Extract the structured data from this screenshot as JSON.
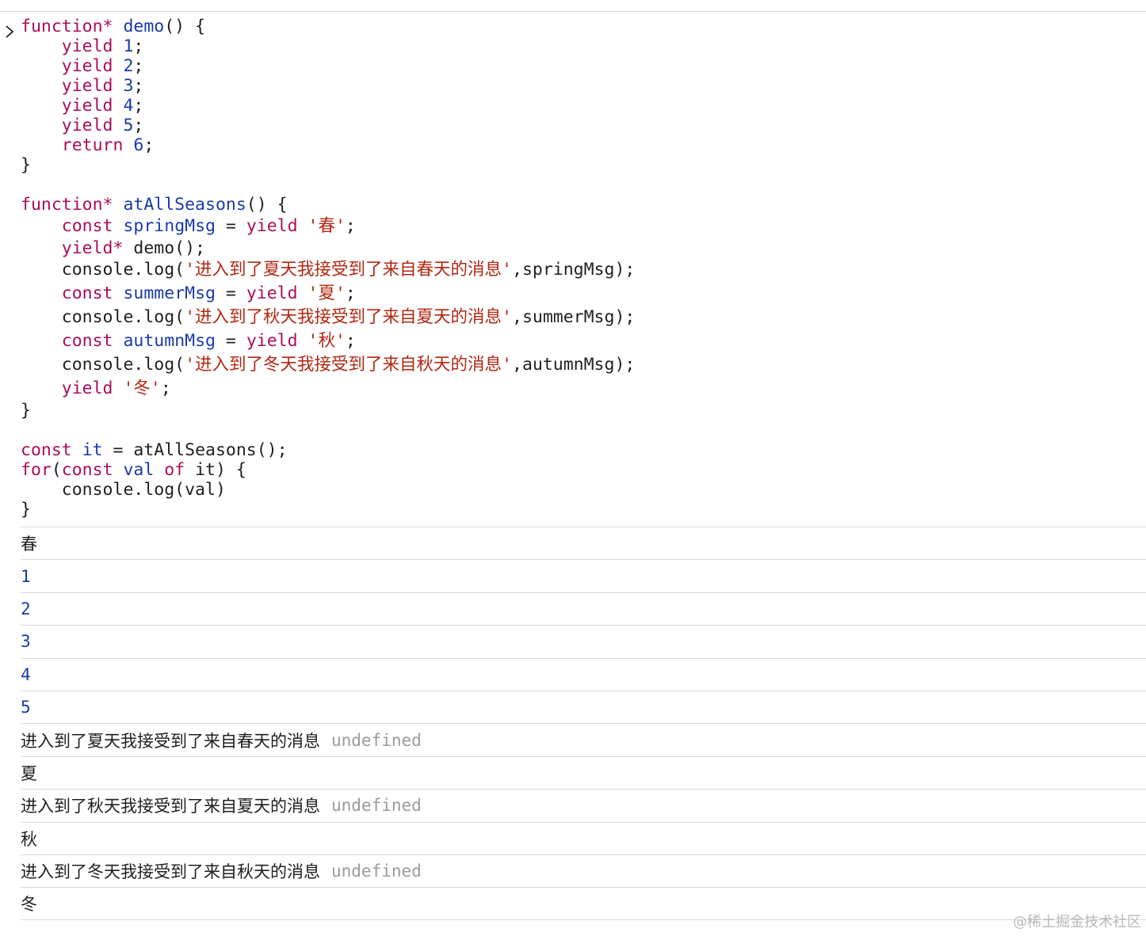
{
  "code": {
    "lines": [
      {
        "tokens": [
          {
            "t": "function*",
            "c": "kw"
          },
          {
            "t": " ",
            "c": "plain"
          },
          {
            "t": "demo",
            "c": "fn"
          },
          {
            "t": "() {",
            "c": "plain"
          }
        ]
      },
      {
        "tokens": [
          {
            "t": "    ",
            "c": "plain"
          },
          {
            "t": "yield",
            "c": "kw"
          },
          {
            "t": " ",
            "c": "plain"
          },
          {
            "t": "1",
            "c": "num"
          },
          {
            "t": ";",
            "c": "plain"
          }
        ]
      },
      {
        "tokens": [
          {
            "t": "    ",
            "c": "plain"
          },
          {
            "t": "yield",
            "c": "kw"
          },
          {
            "t": " ",
            "c": "plain"
          },
          {
            "t": "2",
            "c": "num"
          },
          {
            "t": ";",
            "c": "plain"
          }
        ]
      },
      {
        "tokens": [
          {
            "t": "    ",
            "c": "plain"
          },
          {
            "t": "yield",
            "c": "kw"
          },
          {
            "t": " ",
            "c": "plain"
          },
          {
            "t": "3",
            "c": "num"
          },
          {
            "t": ";",
            "c": "plain"
          }
        ]
      },
      {
        "tokens": [
          {
            "t": "    ",
            "c": "plain"
          },
          {
            "t": "yield",
            "c": "kw"
          },
          {
            "t": " ",
            "c": "plain"
          },
          {
            "t": "4",
            "c": "num"
          },
          {
            "t": ";",
            "c": "plain"
          }
        ]
      },
      {
        "tokens": [
          {
            "t": "    ",
            "c": "plain"
          },
          {
            "t": "yield",
            "c": "kw"
          },
          {
            "t": " ",
            "c": "plain"
          },
          {
            "t": "5",
            "c": "num"
          },
          {
            "t": ";",
            "c": "plain"
          }
        ]
      },
      {
        "tokens": [
          {
            "t": "    ",
            "c": "plain"
          },
          {
            "t": "return",
            "c": "kw"
          },
          {
            "t": " ",
            "c": "plain"
          },
          {
            "t": "6",
            "c": "num"
          },
          {
            "t": ";",
            "c": "plain"
          }
        ]
      },
      {
        "tokens": [
          {
            "t": "}",
            "c": "plain"
          }
        ]
      },
      {
        "tokens": []
      },
      {
        "tokens": [
          {
            "t": "function*",
            "c": "kw"
          },
          {
            "t": " ",
            "c": "plain"
          },
          {
            "t": "atAllSeasons",
            "c": "fn"
          },
          {
            "t": "() {",
            "c": "plain"
          }
        ]
      },
      {
        "tall": true,
        "tokens": [
          {
            "t": "    ",
            "c": "plain"
          },
          {
            "t": "const",
            "c": "kw"
          },
          {
            "t": " ",
            "c": "plain"
          },
          {
            "t": "springMsg",
            "c": "fn"
          },
          {
            "t": " = ",
            "c": "plain"
          },
          {
            "t": "yield",
            "c": "kw"
          },
          {
            "t": " ",
            "c": "plain"
          },
          {
            "t": "'春'",
            "c": "str"
          },
          {
            "t": ";",
            "c": "plain"
          }
        ]
      },
      {
        "tokens": [
          {
            "t": "    ",
            "c": "plain"
          },
          {
            "t": "yield*",
            "c": "kw"
          },
          {
            "t": " demo();",
            "c": "plain"
          }
        ]
      },
      {
        "tall": true,
        "tokens": [
          {
            "t": "    console.log(",
            "c": "plain"
          },
          {
            "t": "'进入到了夏天我接受到了来自春天的消息'",
            "c": "str"
          },
          {
            "t": ",springMsg);",
            "c": "plain"
          }
        ]
      },
      {
        "tall": true,
        "tokens": [
          {
            "t": "    ",
            "c": "plain"
          },
          {
            "t": "const",
            "c": "kw"
          },
          {
            "t": " ",
            "c": "plain"
          },
          {
            "t": "summerMsg",
            "c": "fn"
          },
          {
            "t": " = ",
            "c": "plain"
          },
          {
            "t": "yield",
            "c": "kw"
          },
          {
            "t": " ",
            "c": "plain"
          },
          {
            "t": "'夏'",
            "c": "str"
          },
          {
            "t": ";",
            "c": "plain"
          }
        ]
      },
      {
        "tall": true,
        "tokens": [
          {
            "t": "    console.log(",
            "c": "plain"
          },
          {
            "t": "'进入到了秋天我接受到了来自夏天的消息'",
            "c": "str"
          },
          {
            "t": ",summerMsg);",
            "c": "plain"
          }
        ]
      },
      {
        "tall": true,
        "tokens": [
          {
            "t": "    ",
            "c": "plain"
          },
          {
            "t": "const",
            "c": "kw"
          },
          {
            "t": " ",
            "c": "plain"
          },
          {
            "t": "autumnMsg",
            "c": "fn"
          },
          {
            "t": " = ",
            "c": "plain"
          },
          {
            "t": "yield",
            "c": "kw"
          },
          {
            "t": " ",
            "c": "plain"
          },
          {
            "t": "'秋'",
            "c": "str"
          },
          {
            "t": ";",
            "c": "plain"
          }
        ]
      },
      {
        "tall": true,
        "tokens": [
          {
            "t": "    console.log(",
            "c": "plain"
          },
          {
            "t": "'进入到了冬天我接受到了来自秋天的消息'",
            "c": "str"
          },
          {
            "t": ",autumnMsg);",
            "c": "plain"
          }
        ]
      },
      {
        "tall": true,
        "tokens": [
          {
            "t": "    ",
            "c": "plain"
          },
          {
            "t": "yield",
            "c": "kw"
          },
          {
            "t": " ",
            "c": "plain"
          },
          {
            "t": "'冬'",
            "c": "str"
          },
          {
            "t": ";",
            "c": "plain"
          }
        ]
      },
      {
        "tokens": [
          {
            "t": "}",
            "c": "plain"
          }
        ]
      },
      {
        "tokens": []
      },
      {
        "tokens": [
          {
            "t": "const",
            "c": "kw"
          },
          {
            "t": " ",
            "c": "plain"
          },
          {
            "t": "it",
            "c": "fn"
          },
          {
            "t": " = atAllSeasons();",
            "c": "plain"
          }
        ]
      },
      {
        "tokens": [
          {
            "t": "for",
            "c": "kw"
          },
          {
            "t": "(",
            "c": "plain"
          },
          {
            "t": "const",
            "c": "kw"
          },
          {
            "t": " ",
            "c": "plain"
          },
          {
            "t": "val",
            "c": "fn"
          },
          {
            "t": " ",
            "c": "plain"
          },
          {
            "t": "of",
            "c": "kw"
          },
          {
            "t": " it) {",
            "c": "plain"
          }
        ]
      },
      {
        "tokens": [
          {
            "t": "    console.log(val)",
            "c": "plain"
          }
        ]
      },
      {
        "tokens": [
          {
            "t": "}",
            "c": "plain"
          }
        ]
      }
    ]
  },
  "console_output": [
    {
      "kind": "text",
      "value": "春"
    },
    {
      "kind": "number",
      "value": "1"
    },
    {
      "kind": "number",
      "value": "2"
    },
    {
      "kind": "number",
      "value": "3"
    },
    {
      "kind": "number",
      "value": "4"
    },
    {
      "kind": "number",
      "value": "5"
    },
    {
      "kind": "text",
      "value": "进入到了夏天我接受到了来自春天的消息",
      "extra": "undefined"
    },
    {
      "kind": "text",
      "value": "夏"
    },
    {
      "kind": "text",
      "value": "进入到了秋天我接受到了来自夏天的消息",
      "extra": "undefined"
    },
    {
      "kind": "text",
      "value": "秋"
    },
    {
      "kind": "text",
      "value": "进入到了冬天我接受到了来自秋天的消息",
      "extra": "undefined"
    },
    {
      "kind": "text",
      "value": "冬"
    }
  ],
  "watermark": "@稀土掘金技术社区",
  "icons": {
    "prompt": "chevron-right-icon"
  },
  "colors": {
    "keyword": "#aa0d5a",
    "identifier": "#1a3aa8",
    "string": "#b12712",
    "undefined": "#9b9b9b",
    "divider": "#d7dbe0"
  }
}
